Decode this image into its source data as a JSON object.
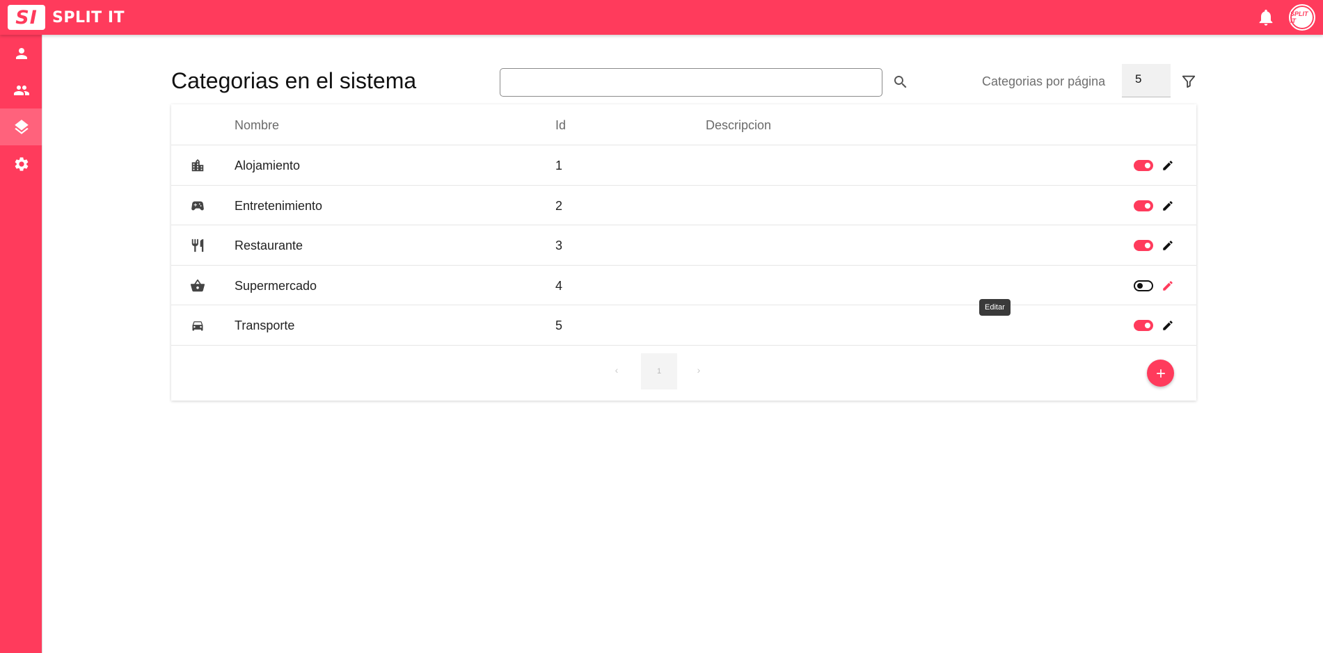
{
  "app": {
    "logo_text": "SI",
    "name": "SPLIT IT",
    "avatar_text": "SPLIT IT"
  },
  "colors": {
    "brand": "#ff3b5c",
    "sidebar_active": "rgba(255,255,255,0.2)"
  },
  "sidebar": {
    "items": [
      {
        "icon": "person-icon",
        "active": false
      },
      {
        "icon": "group-icon",
        "active": false
      },
      {
        "icon": "layers-icon",
        "active": true
      },
      {
        "icon": "gear-icon",
        "active": false
      }
    ]
  },
  "page": {
    "title": "Categorias en el sistema",
    "search_value": "",
    "per_page_label": "Categorias por página",
    "per_page_value": "5"
  },
  "table": {
    "headers": {
      "name": "Nombre",
      "id": "Id",
      "description": "Descripcion"
    },
    "rows": [
      {
        "icon": "building-icon",
        "name": "Alojamiento",
        "id": "1",
        "description": "",
        "enabled": true
      },
      {
        "icon": "gamepad-icon",
        "name": "Entretenimiento",
        "id": "2",
        "description": "",
        "enabled": true
      },
      {
        "icon": "restaurant-icon",
        "name": "Restaurante",
        "id": "3",
        "description": "",
        "enabled": true
      },
      {
        "icon": "shopping-basket-icon",
        "name": "Supermercado",
        "id": "4",
        "description": "",
        "enabled": false
      },
      {
        "icon": "car-icon",
        "name": "Transporte",
        "id": "5",
        "description": "",
        "enabled": true
      }
    ]
  },
  "tooltip": {
    "text": "Editar"
  },
  "pagination": {
    "prev": "‹",
    "current_page": "1",
    "next": "›"
  }
}
